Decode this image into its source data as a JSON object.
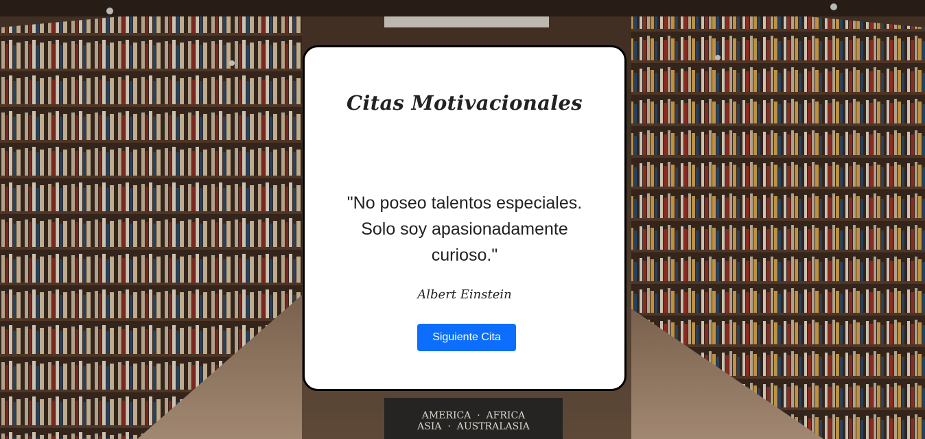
{
  "card": {
    "title": "Citas Motivacionales",
    "quote": "\"No poseo talentos especiales. Solo soy apasionadamente curioso.\"",
    "author": "Albert Einstein",
    "next_button_label": "Siguiente Cita"
  },
  "background": {
    "sign_line_1": "AMERICA  ·  AFRICA",
    "sign_line_2": "ASIA  ·  AUSTRALASIA"
  }
}
